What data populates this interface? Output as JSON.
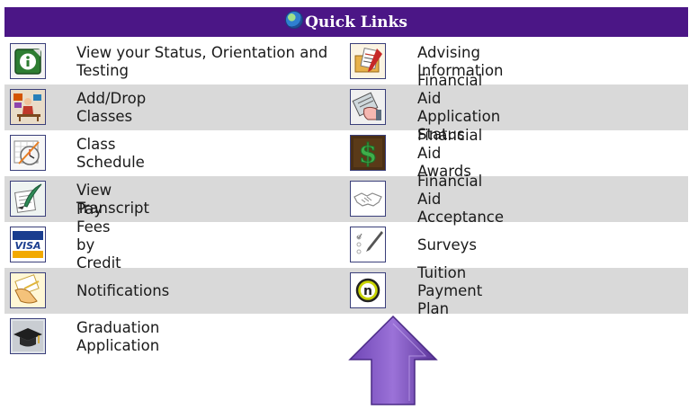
{
  "header": {
    "title": "Quick Links",
    "globe_icon": "globe-icon"
  },
  "links": {
    "status": {
      "label": "View your Status, Orientation and Testing",
      "icon": "info-icon"
    },
    "add_drop": {
      "label": "Add/Drop Classes",
      "icon": "student-desk-icon"
    },
    "schedule": {
      "label": "Class Schedule",
      "icon": "calendar-clock-icon"
    },
    "transcript": {
      "label": "View Transcript",
      "icon": "quill-document-icon"
    },
    "pay_fees": {
      "label": "Pay Fees by Credit Card",
      "icon": "visa-card-icon"
    },
    "notifications": {
      "label": "Notifications",
      "icon": "envelope-hand-icon"
    },
    "graduation": {
      "label": "Graduation Application",
      "icon": "graduation-cap-icon"
    },
    "advising": {
      "label": "Advising Information",
      "icon": "folder-documents-icon"
    },
    "fa_status": {
      "label": "Financial Aid Application Status",
      "icon": "hand-form-icon"
    },
    "fa_awards": {
      "label": "Financial Aid Awards",
      "icon": "dollar-sign-icon"
    },
    "fa_acceptance": {
      "label": "Financial Aid Acceptance",
      "icon": "handshake-icon"
    },
    "surveys": {
      "label": "Surveys",
      "icon": "checklist-pen-icon"
    },
    "tuition_plan": {
      "label": "Tuition Payment Plan",
      "icon": "nelnet-n-icon"
    }
  },
  "colors": {
    "header_bg": "#4b1686",
    "row_shade": "#d9d9d9",
    "arrow": "#8e63cf"
  },
  "annotation": {
    "icon": "up-arrow-icon",
    "points_to": "Tuition Payment Plan"
  }
}
